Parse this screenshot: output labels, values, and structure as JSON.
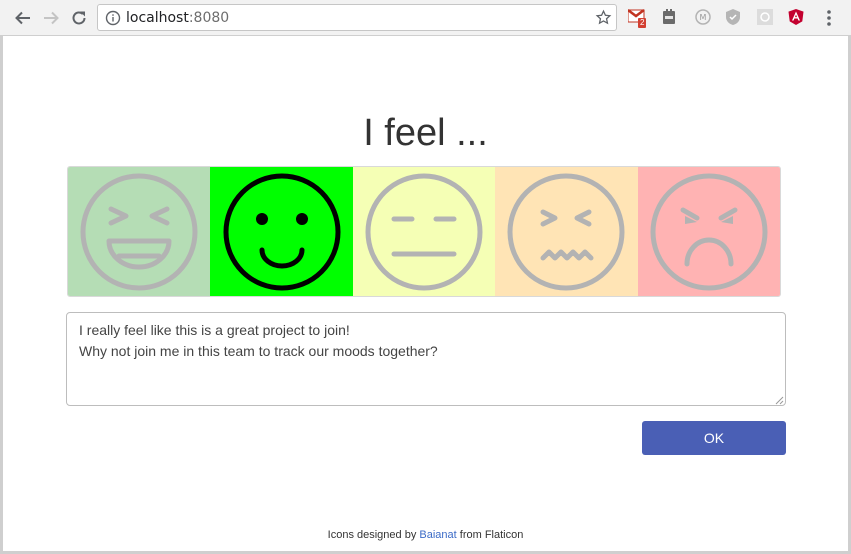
{
  "browser": {
    "url_host": "localhost",
    "url_port": ":8080",
    "gmail_badge": "2"
  },
  "page": {
    "title": "I feel ...",
    "moods": [
      {
        "name": "ecstatic",
        "bg": "#b5ddb5",
        "selected": false
      },
      {
        "name": "happy",
        "bg": "#00ff00",
        "selected": true
      },
      {
        "name": "neutral",
        "bg": "#f5ffb5",
        "selected": false
      },
      {
        "name": "uneasy",
        "bg": "#ffe4b5",
        "selected": false
      },
      {
        "name": "angry",
        "bg": "#ffb3b3",
        "selected": false
      }
    ],
    "comment_value": "I really feel like this is a great project to join!\nWhy not join me in this team to track our moods together?",
    "ok_label": "OK"
  },
  "footer": {
    "prefix": "Icons designed by ",
    "author": "Baianat",
    "suffix": " from Flaticon"
  },
  "colors": {
    "accent": "#4a5fb5",
    "face_inactive": "#b3b3b3",
    "face_active": "#000000"
  }
}
